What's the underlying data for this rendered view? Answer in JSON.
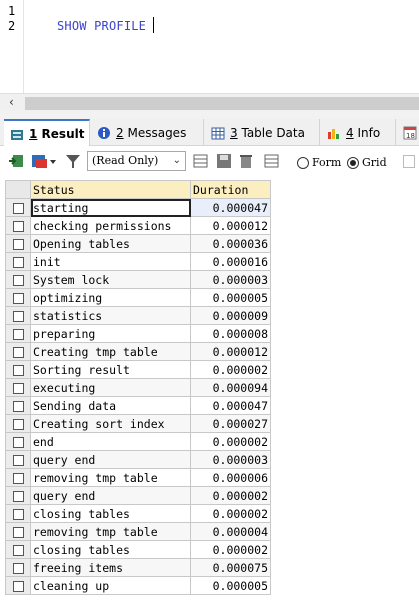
{
  "editor": {
    "line_numbers": [
      "1",
      "2"
    ],
    "code": "SHOW PROFILE"
  },
  "tabs": [
    {
      "num": "1",
      "label": "Result",
      "icon": "result-grid-icon"
    },
    {
      "num": "2",
      "label": "Messages",
      "icon": "info-circle-icon"
    },
    {
      "num": "3",
      "label": "Table Data",
      "icon": "table-icon"
    },
    {
      "num": "4",
      "label": "Info",
      "icon": "bar-chart-icon"
    },
    {
      "num": "",
      "label": "",
      "icon": "history-icon"
    }
  ],
  "toolbar": {
    "mode_select": "(Read Only)",
    "radio_form": "Form",
    "radio_grid": "Grid"
  },
  "grid": {
    "headers": [
      "Status",
      "Duration"
    ],
    "rows": [
      [
        "starting",
        "0.000047"
      ],
      [
        "checking permissions",
        "0.000012"
      ],
      [
        "Opening tables",
        "0.000036"
      ],
      [
        "init",
        "0.000016"
      ],
      [
        "System lock",
        "0.000003"
      ],
      [
        "optimizing",
        "0.000005"
      ],
      [
        "statistics",
        "0.000009"
      ],
      [
        "preparing",
        "0.000008"
      ],
      [
        "Creating tmp table",
        "0.000012"
      ],
      [
        "Sorting result",
        "0.000002"
      ],
      [
        "executing",
        "0.000094"
      ],
      [
        "Sending data",
        "0.000047"
      ],
      [
        "Creating sort index",
        "0.000027"
      ],
      [
        "end",
        "0.000002"
      ],
      [
        "query end",
        "0.000003"
      ],
      [
        "removing tmp table",
        "0.000006"
      ],
      [
        "query end",
        "0.000002"
      ],
      [
        "closing tables",
        "0.000002"
      ],
      [
        "removing tmp table",
        "0.000004"
      ],
      [
        "closing tables",
        "0.000002"
      ],
      [
        "freeing items",
        "0.000075"
      ],
      [
        "cleaning up",
        "0.000005"
      ]
    ]
  },
  "colors": {
    "keyword": "#3b44c8",
    "header_bg": "#fbeec0",
    "tab_accent": "#3d76c6"
  }
}
